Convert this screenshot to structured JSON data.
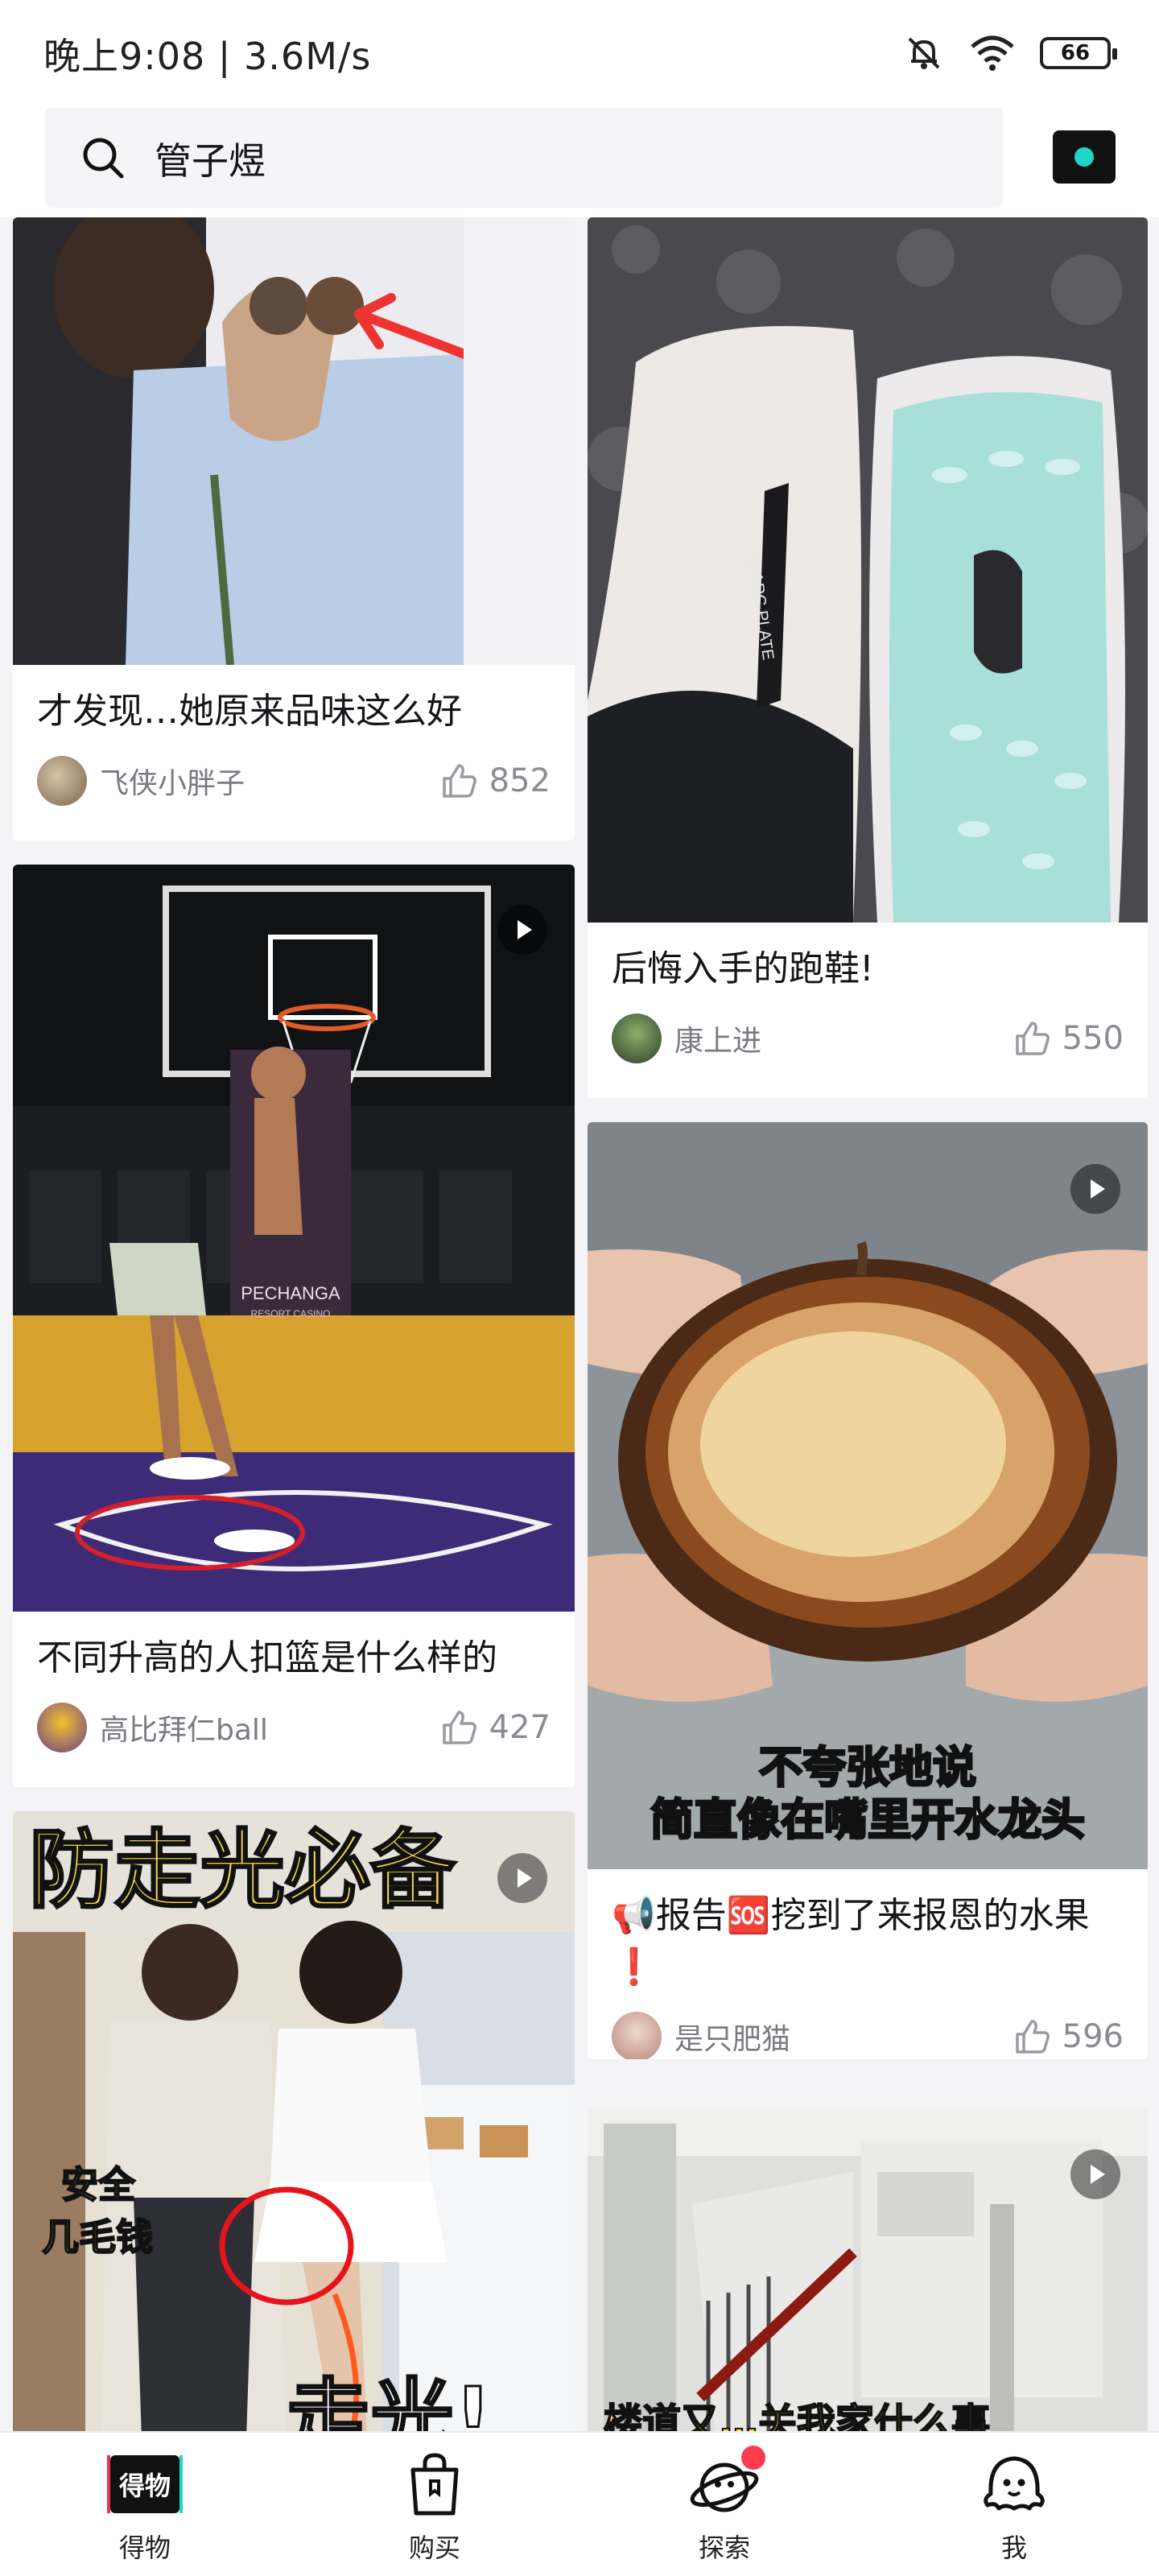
{
  "status_bar": {
    "time_speed": "晚上9:08 | 3.6M/s",
    "battery": "66",
    "icons": [
      "mute-bell-icon",
      "wifi-icon",
      "battery-icon"
    ]
  },
  "search": {
    "query": "管子煜",
    "icon": "search-icon",
    "camera_icon": "camera-icon"
  },
  "feed": {
    "left": [
      {
        "title": "才发现…她原来品味这么好",
        "author": "飞侠小胖子",
        "likes": "852",
        "video": false
      },
      {
        "title": "不同升高的人扣篮是什么样的",
        "author": "高比拜仁ball",
        "likes": "427",
        "video": true
      },
      {
        "title": "",
        "author": "",
        "likes": "",
        "video": true,
        "overlay": {
          "headline": "防走光必备",
          "label_a": "安全",
          "label_b": "几毛钱",
          "bottom": "走光!"
        }
      }
    ],
    "right": [
      {
        "title": "后悔入手的跑鞋!",
        "author": "康上进",
        "likes": "550",
        "video": false
      },
      {
        "title": "📢报告🆘挖到了来报恩的水果❗",
        "author": "是只肥猫",
        "likes": "596",
        "video": true,
        "overlay": {
          "line1": "不夸张地说",
          "line2": "简直像在嘴里开水龙头"
        }
      },
      {
        "title": "",
        "author": "",
        "likes": "",
        "video": true,
        "overlay": {
          "caption": "楼道又…关我家什么事"
        }
      }
    ]
  },
  "shoe_text": "Q-ARC PLATE",
  "court_text": {
    "brand": "PECHANGA",
    "sub": "RESORT CASINO"
  },
  "bottom_nav": [
    {
      "label": "得物",
      "icon": "dewu-logo-icon"
    },
    {
      "label": "购买",
      "icon": "shopping-bag-icon"
    },
    {
      "label": "探索",
      "icon": "planet-icon"
    },
    {
      "label": "我",
      "icon": "ghost-icon"
    }
  ],
  "logo_text": "得物",
  "colors": {
    "accent_teal": "#1fd6c8",
    "accent_red": "#e8374a",
    "badge": "#ff3b4f"
  }
}
